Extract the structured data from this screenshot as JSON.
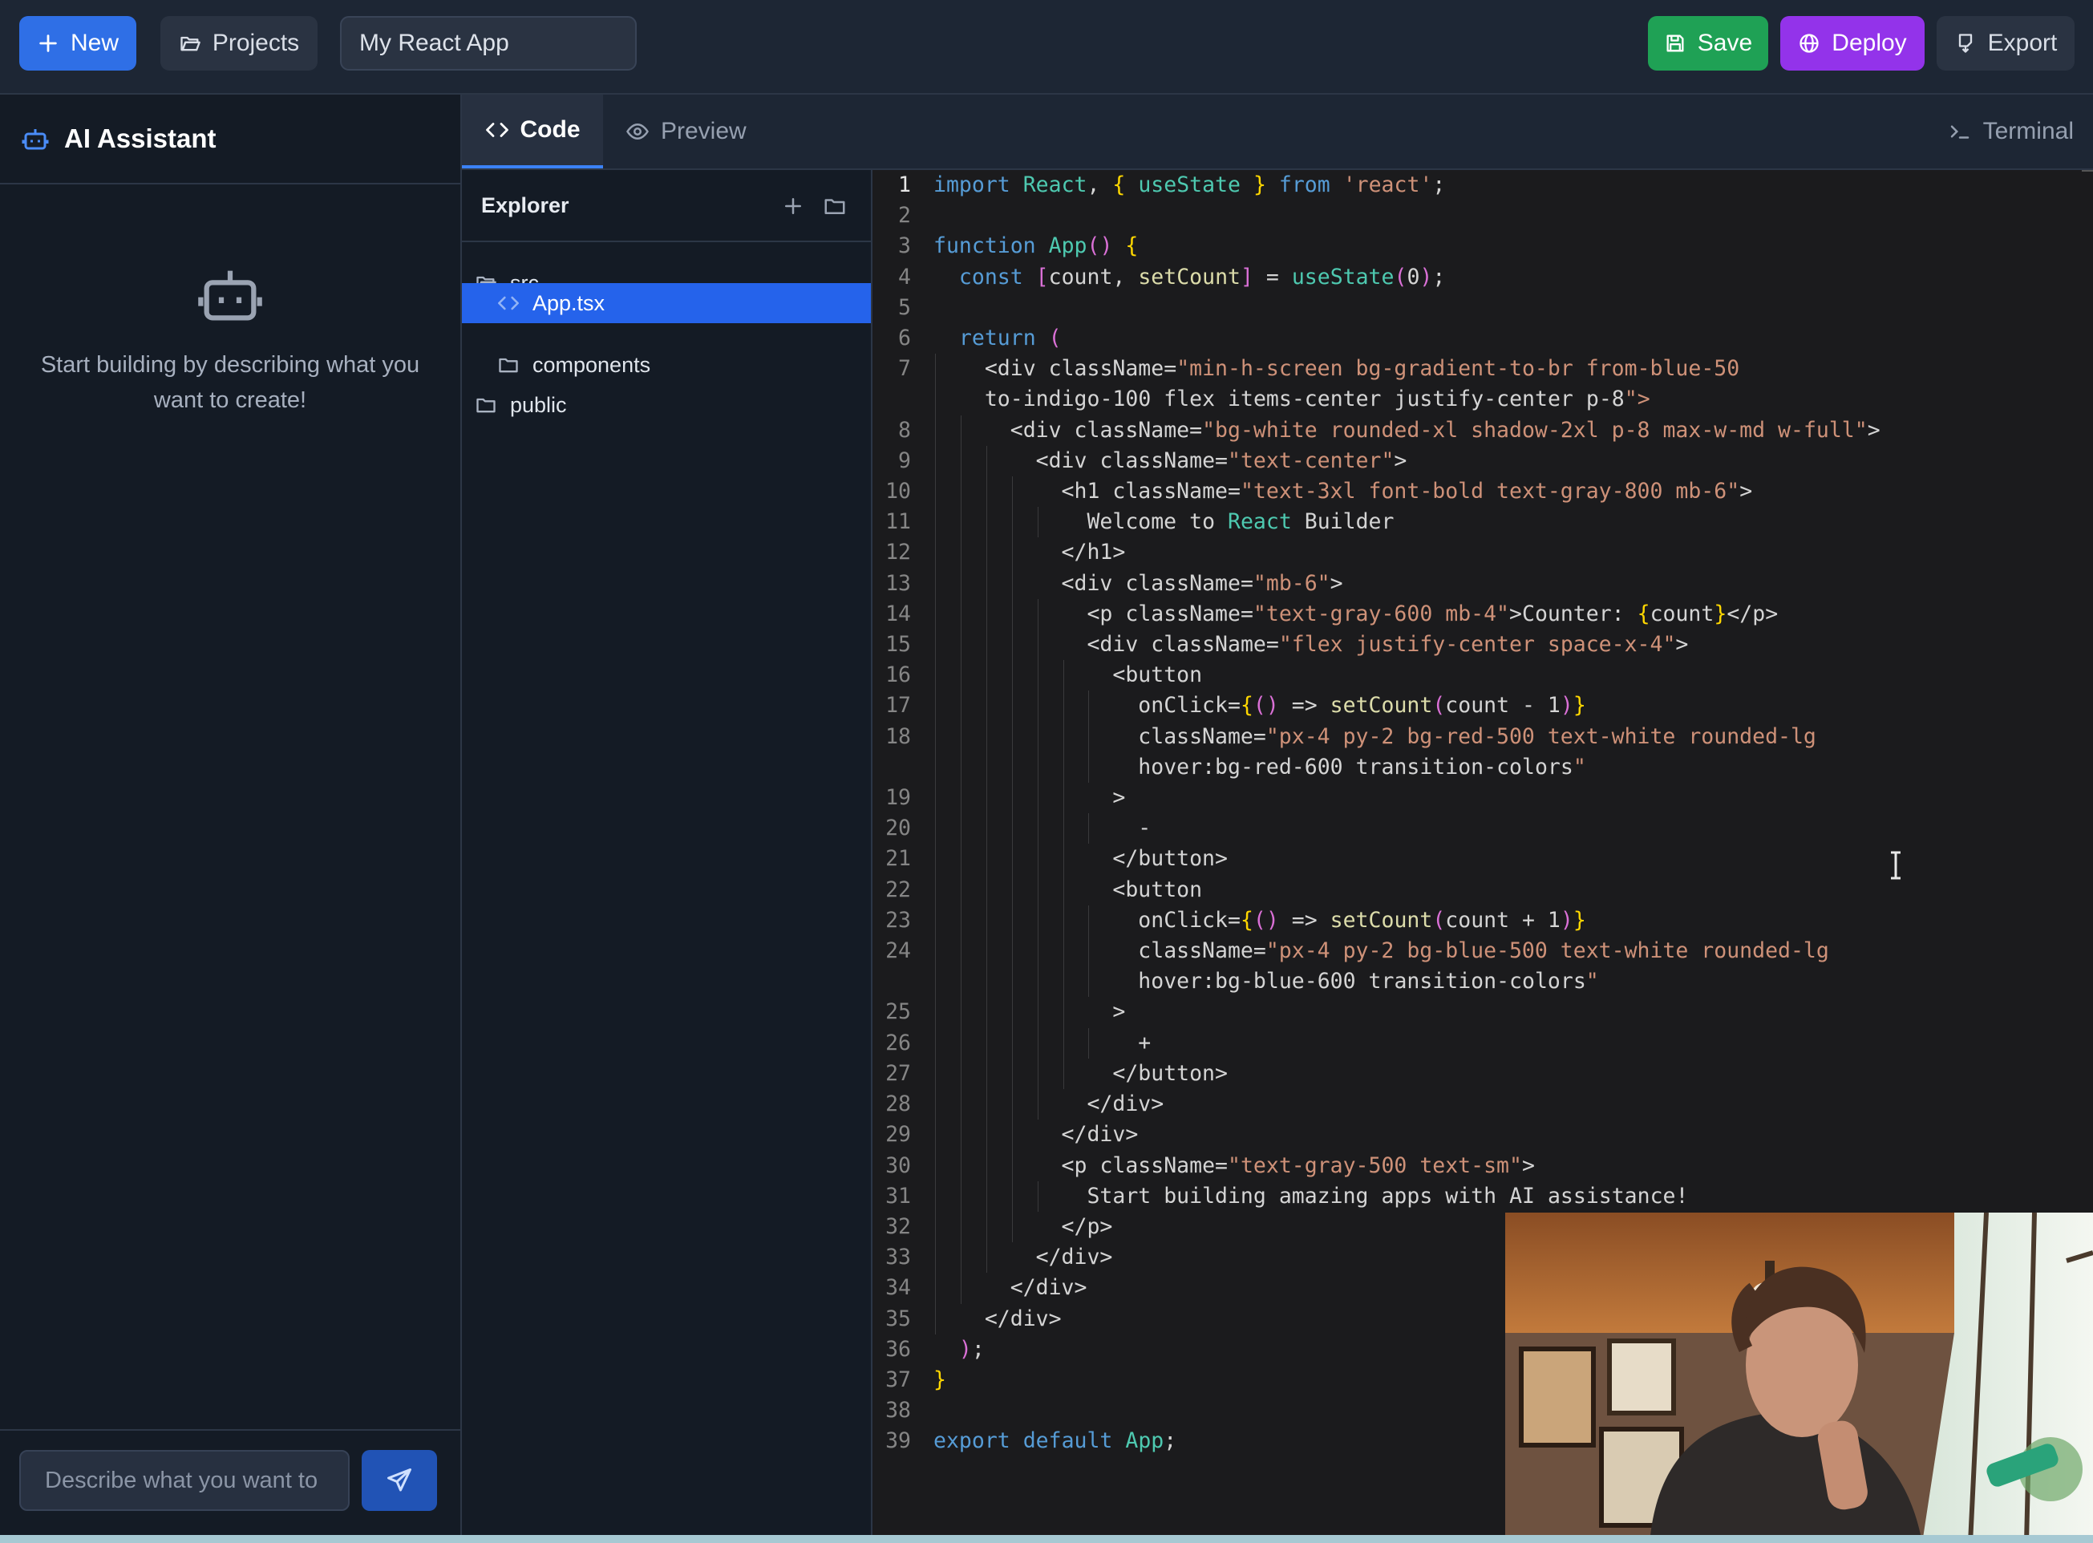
{
  "topbar": {
    "new_label": "New",
    "projects_label": "Projects",
    "project_name": "My React App",
    "save_label": "Save",
    "deploy_label": "Deploy",
    "export_label": "Export"
  },
  "ai_panel": {
    "title": "AI Assistant",
    "empty_message": "Start building by describing what you want to create!",
    "input_placeholder": "Describe what you want to"
  },
  "tabs": {
    "code_label": "Code",
    "preview_label": "Preview",
    "terminal_label": "Terminal"
  },
  "explorer": {
    "title": "Explorer",
    "items": [
      {
        "label": "src",
        "type": "folder",
        "selected": false
      },
      {
        "label": "App.tsx",
        "type": "file",
        "selected": true
      },
      {
        "label": "components",
        "type": "folder",
        "selected": false
      },
      {
        "label": "public",
        "type": "folder",
        "selected": false
      }
    ]
  },
  "editor": {
    "file": "App.tsx",
    "lines": [
      "import React, { useState } from 'react';",
      "",
      "function App() {",
      "  const [count, setCount] = useState(0);",
      "",
      "  return (",
      "    <div className=\"min-h-screen bg-gradient-to-br from-blue-50 to-indigo-100 flex items-center justify-center p-8\">",
      "      <div className=\"bg-white rounded-xl shadow-2xl p-8 max-w-md w-full\">",
      "        <div className=\"text-center\">",
      "          <h1 className=\"text-3xl font-bold text-gray-800 mb-6\">",
      "            Welcome to React Builder",
      "          </h1>",
      "          <div className=\"mb-6\">",
      "            <p className=\"text-gray-600 mb-4\">Counter: {count}</p>",
      "            <div className=\"flex justify-center space-x-4\">",
      "              <button",
      "                onClick={() => setCount(count - 1)}",
      "                className=\"px-4 py-2 bg-red-500 text-white rounded-lg hover:bg-red-600 transition-colors\"",
      "              >",
      "                -",
      "              </button>",
      "              <button",
      "                onClick={() => setCount(count + 1)}",
      "                className=\"px-4 py-2 bg-blue-500 text-white rounded-lg hover:bg-blue-600 transition-colors\"",
      "              >",
      "                +",
      "              </button>",
      "            </div>",
      "          </div>",
      "          <p className=\"text-gray-500 text-sm\">",
      "            Start building amazing apps with AI assistance!",
      "          </p>",
      "        </div>",
      "      </div>",
      "    </div>",
      "  );",
      "}",
      "",
      "export default App;"
    ]
  },
  "colors": {
    "accent_blue": "#2f6fe6",
    "save_green": "#1fa155",
    "deploy_purple": "#9333ea",
    "selected_file": "#2563eb"
  },
  "icons": [
    "plus-icon",
    "folder-open-icon",
    "save-icon",
    "globe-icon",
    "export-icon",
    "robot-icon",
    "code-icon",
    "eye-icon",
    "terminal-icon",
    "folder-icon",
    "file-code-icon",
    "new-folder-icon",
    "send-icon"
  ]
}
